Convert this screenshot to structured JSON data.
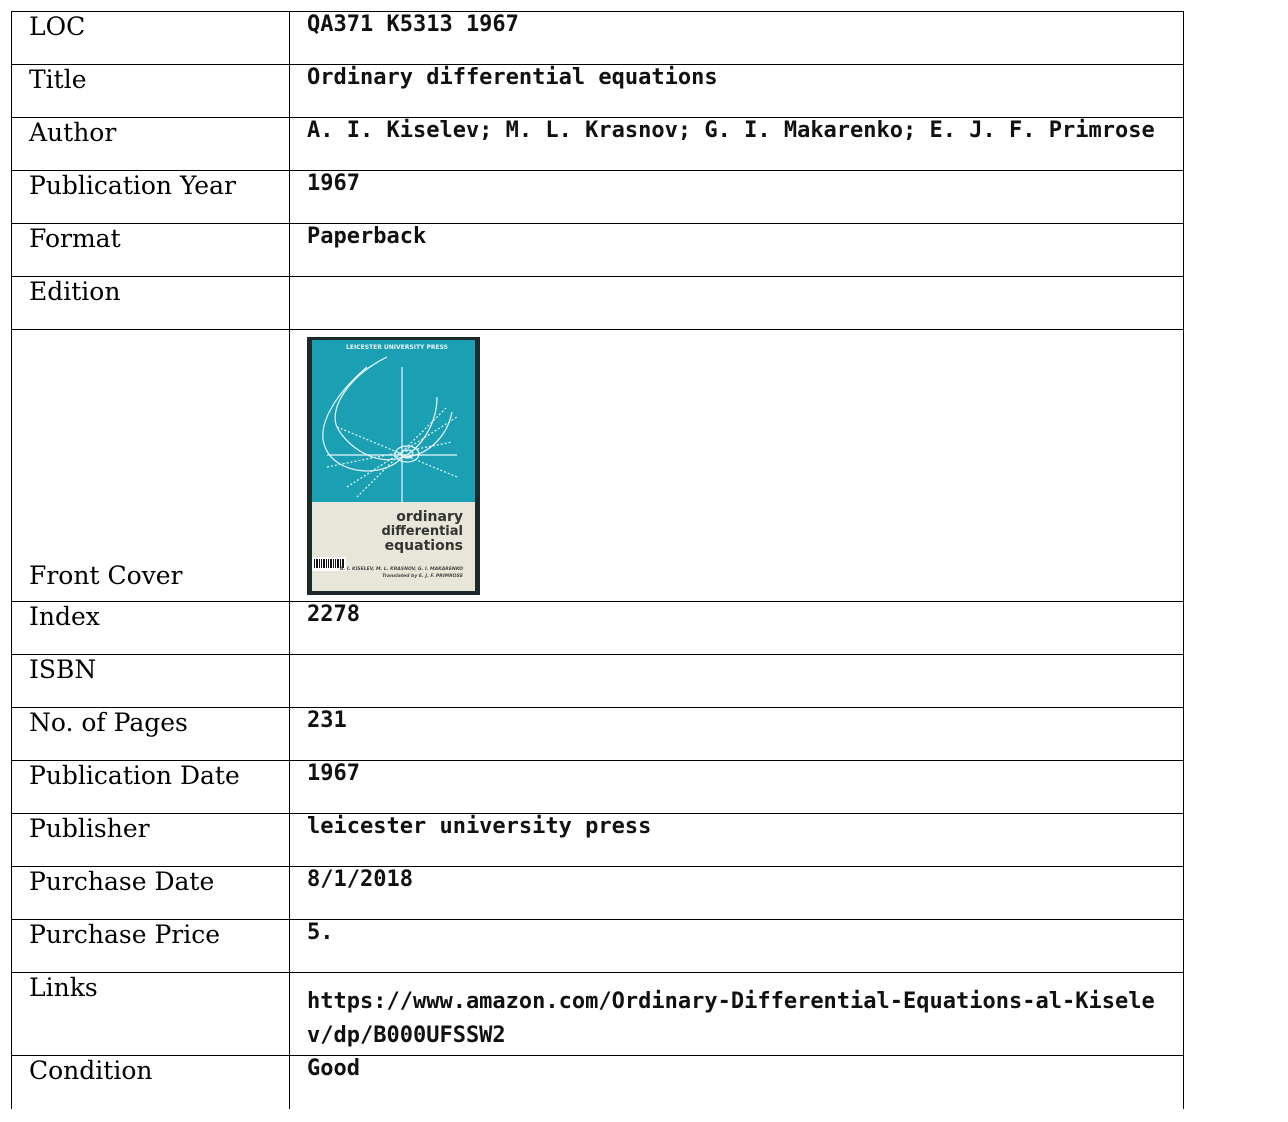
{
  "rows": [
    {
      "label": "LOC",
      "value": "QA371 K5313 1967"
    },
    {
      "label": "Title",
      "value": "Ordinary differential equations"
    },
    {
      "label": "Author",
      "value": "A. I. Kiselev; M. L. Krasnov; G. I. Makarenko; E. J. F. Primrose"
    },
    {
      "label": "Publication Year",
      "value": "1967"
    },
    {
      "label": "Format",
      "value": "Paperback"
    },
    {
      "label": "Edition",
      "value": ""
    }
  ],
  "cover": {
    "label": "Front Cover",
    "publisher_band": "LEICESTER UNIVERSITY PRESS",
    "title_line1": "ordinary",
    "title_line2": "differential",
    "title_line3": "equations",
    "authors_line": "A. I. KISELEV, M. L. KRASNOV, G. I. MAKARENKO",
    "translator_line": "Translated by E. J. F. PRIMROSE",
    "teal_color": "#1a9fb3",
    "cream_color": "#e7e6d8"
  },
  "rows2": [
    {
      "label": "Index",
      "value": "2278"
    },
    {
      "label": "ISBN",
      "value": ""
    },
    {
      "label": "No. of Pages",
      "value": "231"
    },
    {
      "label": "Publication Date",
      "value": "1967"
    },
    {
      "label": "Publisher",
      "value": "leicester university press"
    },
    {
      "label": "Purchase Date",
      "value": "8/1/2018"
    },
    {
      "label": "Purchase Price",
      "value": "5."
    },
    {
      "label": "Links",
      "value": "https://www.amazon.com/Ordinary-Differential-Equations-al-Kiselev/dp/B000UFSSW2"
    },
    {
      "label": "Condition",
      "value": "Good"
    }
  ]
}
